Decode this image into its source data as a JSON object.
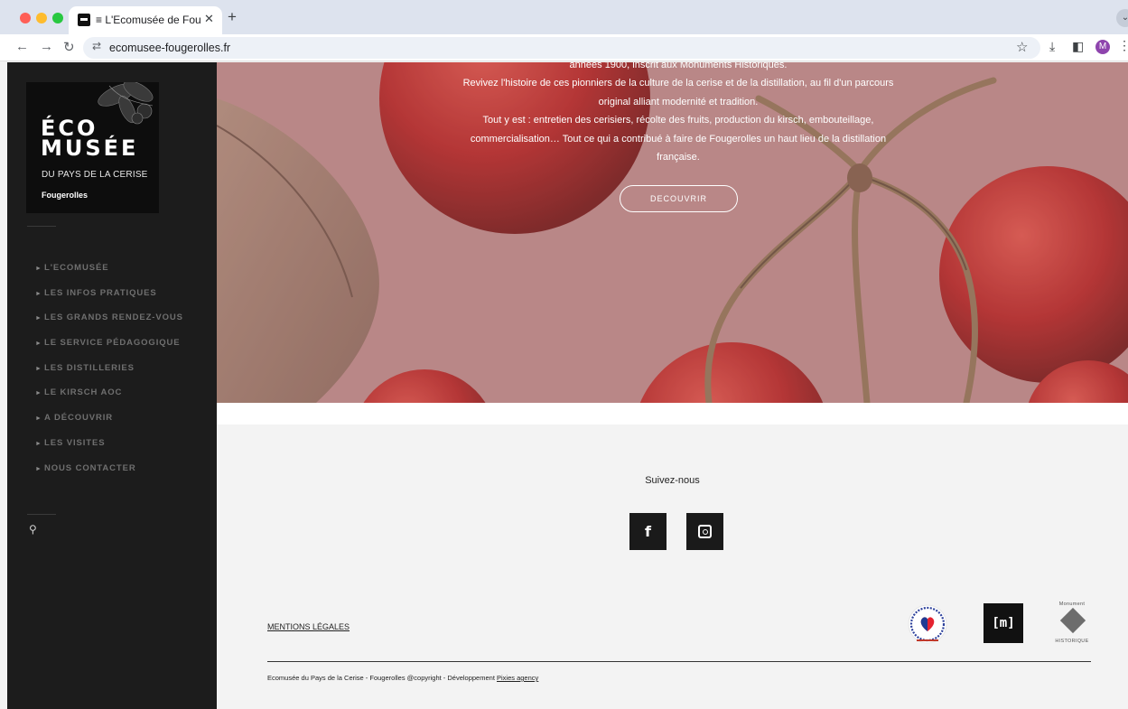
{
  "browser": {
    "tab_title": "≡ L'Ecomusée de Fougerolles",
    "tab_close": "✕",
    "new_tab": "+",
    "tab_menu": "⌄",
    "url": "ecomusee-fougerolles.fr",
    "avatar_letter": "M",
    "icons": {
      "back": "←",
      "forward": "→",
      "reload": "↻",
      "site_info": "⇄",
      "bookmark": "☆",
      "download": "⤓",
      "side_panel": "◧",
      "menu": "⋮"
    }
  },
  "logo": {
    "line1": "ÉCO",
    "line2": "MUSÉE",
    "subtitle": "DU PAYS DE LA CERISE",
    "town": "Fougerolles"
  },
  "menu": {
    "bullet": "►",
    "items": [
      {
        "label": "L'ECOMUSÉE"
      },
      {
        "label": "LES INFOS PRATIQUES"
      },
      {
        "label": "LES GRANDS RENDEZ-VOUS"
      },
      {
        "label": "LE SERVICE PÉDAGOGIQUE"
      },
      {
        "label": "LES DISTILLERIES"
      },
      {
        "label": "LE KIRSCH AOC"
      },
      {
        "label": "A DÉCOUVRIR"
      },
      {
        "label": "LES VISITES"
      },
      {
        "label": "NOUS CONTACTER"
      }
    ],
    "search_icon": "⚲"
  },
  "hero": {
    "lines": [
      "années 1900, inscrit aux Monuments Historiques.",
      "Revivez l'histoire de ces pionniers de la culture de la cerise et de la distillation, au fil d'un parcours",
      "original alliant modernité et tradition.",
      "Tout y est : entretien des cerisiers, récolte des fruits, production du kirsch, embouteillage,",
      "commercialisation… Tout ce qui a contribué à faire de Fougerolles un haut lieu de la distillation",
      "française."
    ],
    "button": "DECOUVRIR"
  },
  "footer": {
    "follow": "Suivez-nous",
    "facebook": "f",
    "legal": "MENTIONS LÉGALES",
    "copyright": "Ecomusée du Pays de la Cerise - Fougerolles @copyright - Développement ",
    "agency": "Pixies agency",
    "badge_m": "[m]",
    "mh_top": "Monument",
    "mh_bottom": "HISTORIQUE"
  },
  "colors": {
    "sidebar": "#1c1c1c",
    "hero_tint": "#b57f7f",
    "cherry": "#b01e1e"
  }
}
